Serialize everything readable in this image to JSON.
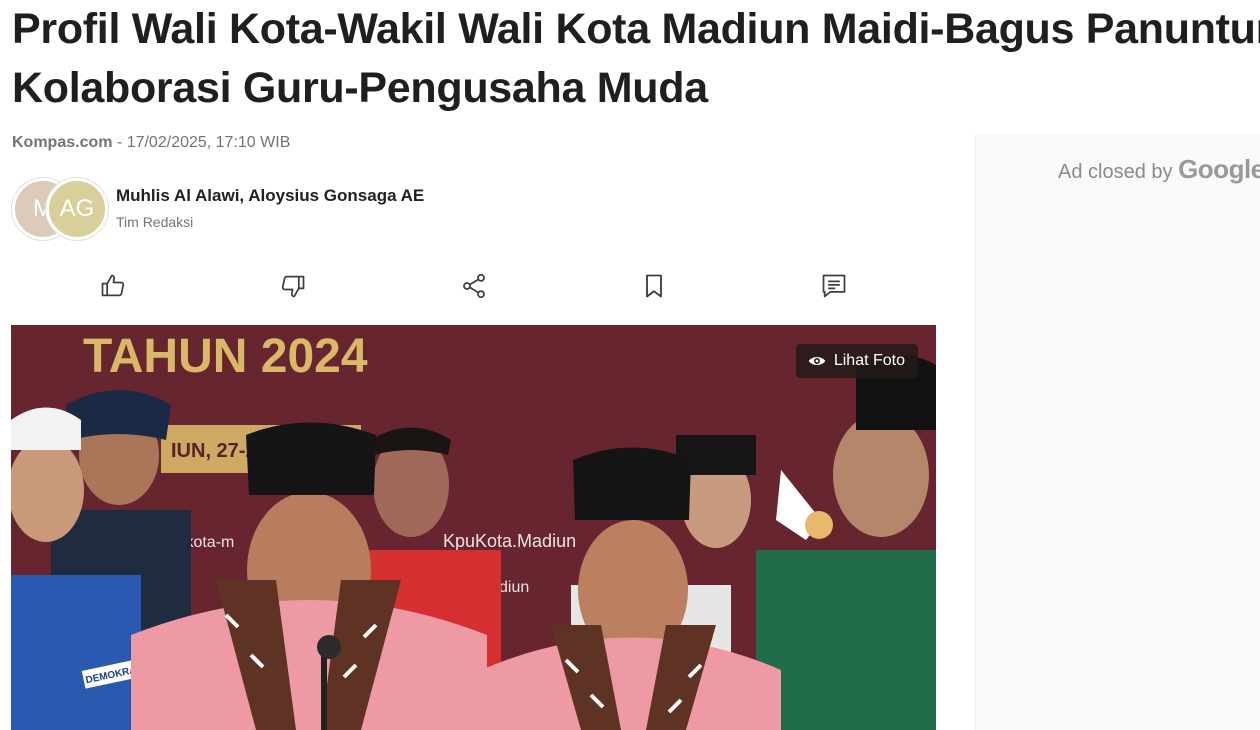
{
  "article": {
    "title_line1": "Profil Wali Kota-Wakil Wali Kota Madiun Maidi-Bagus Panuntun",
    "title_line2": "Kolaborasi Guru-Pengusaha Muda",
    "source": "Kompas.com",
    "separator": " - ",
    "published": "17/02/2025, 17:10 WIB",
    "authors": "Muhlis Al Alawi, Aloysius Gonsaga AE",
    "author_role": "Tim Redaksi",
    "avatars": [
      {
        "initials": "M",
        "color": "#dccbb8"
      },
      {
        "initials": "AG",
        "color": "#d8cf9a"
      }
    ]
  },
  "actions": {
    "like_icon": "thumbs-up-icon",
    "dislike_icon": "thumbs-down-icon",
    "share_icon": "share-icon",
    "bookmark_icon": "bookmark-icon",
    "comment_icon": "comment-icon"
  },
  "photo": {
    "view_label": "Lihat Foto",
    "view_icon": "eye-icon",
    "backdrop_text": "TAHUN 2024",
    "backdrop_sub": "IUN, 27-2",
    "backdrop_social": "KpuKota.Madiun",
    "backdrop_handle": "/kota-m",
    "backdrop_city": "diun",
    "badge_text": "DEMOKRAT",
    "backdrop_color": "#6e2a33"
  },
  "ad": {
    "closed_label": "Ad closed by",
    "brand": "Google"
  }
}
